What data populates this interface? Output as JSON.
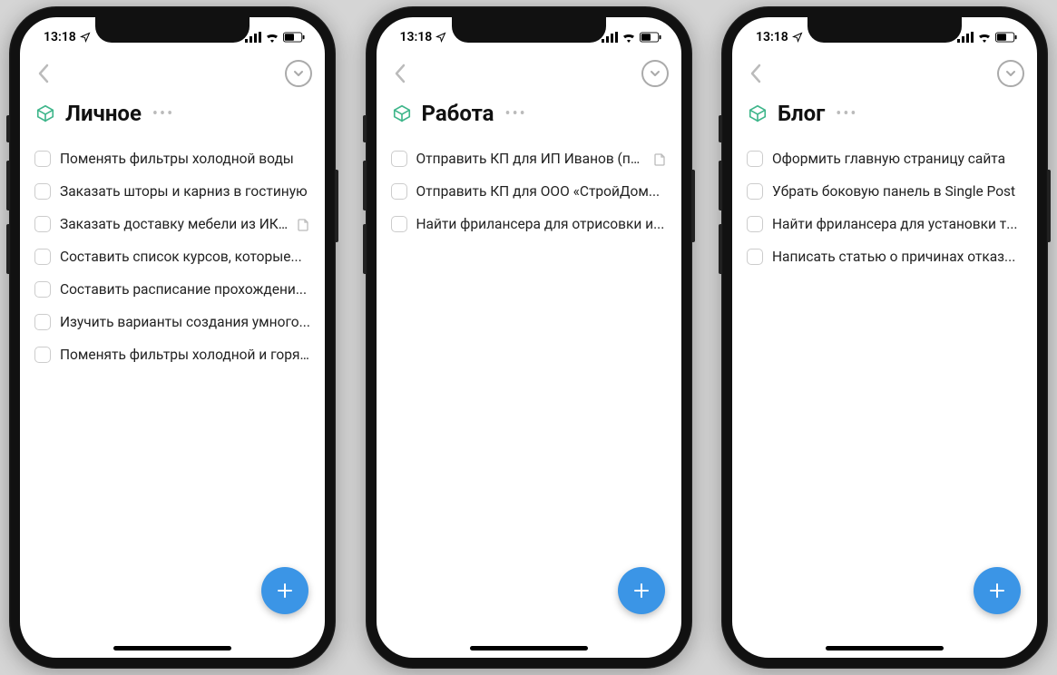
{
  "status": {
    "time": "13:18",
    "location_icon": "location-arrow",
    "signal_bars": 4,
    "wifi": true,
    "battery_level": 0.55
  },
  "accent": "#3b95e6",
  "icon_accent": "#3fb68b",
  "phones": [
    {
      "title": "Личное",
      "tasks": [
        {
          "label": "Поменять фильтры холодной воды",
          "has_note": false
        },
        {
          "label": "Заказать шторы и карниз в гостиную",
          "has_note": false
        },
        {
          "label": "Заказать доставку мебели из ИК...",
          "has_note": true
        },
        {
          "label": "Составить список курсов, которые...",
          "has_note": false
        },
        {
          "label": "Составить расписание прохождени...",
          "has_note": false
        },
        {
          "label": "Изучить варианты создания умного...",
          "has_note": false
        },
        {
          "label": "Поменять фильтры холодной и горя...",
          "has_note": false
        }
      ]
    },
    {
      "title": "Работа",
      "tasks": [
        {
          "label": "Отправить КП для ИП Иванов (по...",
          "has_note": true
        },
        {
          "label": "Отправить КП для ООО «СтройДом...",
          "has_note": false
        },
        {
          "label": "Найти фрилансера для отрисовки и...",
          "has_note": false
        }
      ]
    },
    {
      "title": "Блог",
      "tasks": [
        {
          "label": "Оформить главную страницу сайта",
          "has_note": false
        },
        {
          "label": "Убрать боковую панель в Single Post",
          "has_note": false
        },
        {
          "label": "Найти фрилансера для установки т...",
          "has_note": false
        },
        {
          "label": "Написать статью о причинах отказ...",
          "has_note": false
        }
      ]
    }
  ]
}
